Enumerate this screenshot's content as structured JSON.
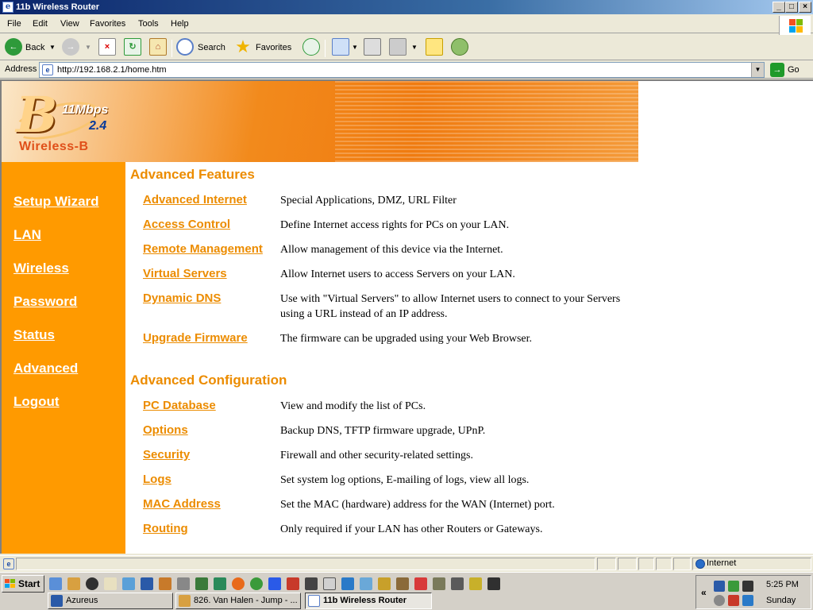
{
  "window": {
    "title": "11b Wireless Router"
  },
  "menu": [
    "File",
    "Edit",
    "View",
    "Favorites",
    "Tools",
    "Help"
  ],
  "toolbar": {
    "back_label": "Back",
    "search_label": "Search",
    "favorites_label": "Favorites"
  },
  "address": {
    "label": "Address",
    "url": "http://192.168.2.1/home.htm",
    "go_label": "Go"
  },
  "logo": {
    "speed": "11Mbps",
    "version": "2.4",
    "name": "Wireless-B"
  },
  "sidebar": {
    "items": [
      {
        "label": "Setup Wizard"
      },
      {
        "label": "LAN"
      },
      {
        "label": "Wireless"
      },
      {
        "label": "Password"
      },
      {
        "label": "Status"
      },
      {
        "label": "Advanced"
      },
      {
        "label": "Logout"
      }
    ]
  },
  "advanced_features": {
    "title": "Advanced Features",
    "rows": [
      {
        "link": "Advanced Internet",
        "desc": "Special Applications, DMZ, URL Filter"
      },
      {
        "link": "Access Control",
        "desc": "Define Internet access rights for PCs on your LAN."
      },
      {
        "link": "Remote Management",
        "desc": "Allow management of this device via the Internet."
      },
      {
        "link": "Virtual Servers",
        "desc": "Allow Internet users to access Servers on your LAN."
      },
      {
        "link": "Dynamic DNS",
        "desc": "Use with \"Virtual Servers\" to allow Internet users to connect to your Servers using a URL instead of an IP address."
      },
      {
        "link": "Upgrade Firmware",
        "desc": "The firmware can be upgraded using your Web Browser."
      }
    ]
  },
  "advanced_configuration": {
    "title": "Advanced Configuration",
    "rows": [
      {
        "link": "PC Database",
        "desc": "View and modify the list of PCs."
      },
      {
        "link": "Options",
        "desc": "Backup DNS, TFTP firmware upgrade, UPnP."
      },
      {
        "link": "Security",
        "desc": "Firewall and other security-related settings."
      },
      {
        "link": "Logs",
        "desc": "Set system log options, E-mailing of logs, view all logs."
      },
      {
        "link": "MAC Address",
        "desc": "Set the MAC (hardware) address for the WAN (Internet) port."
      },
      {
        "link": "Routing",
        "desc": "Only required if your LAN has other Routers or Gateways."
      }
    ]
  },
  "statusbar": {
    "zone": "Internet"
  },
  "taskbar": {
    "start_label": "Start",
    "tasks": [
      {
        "label": "Azureus"
      },
      {
        "label": "826. Van Halen - Jump - ..."
      },
      {
        "label": "11b Wireless Router"
      }
    ],
    "clock_time": "5:25 PM",
    "clock_day": "Sunday"
  }
}
